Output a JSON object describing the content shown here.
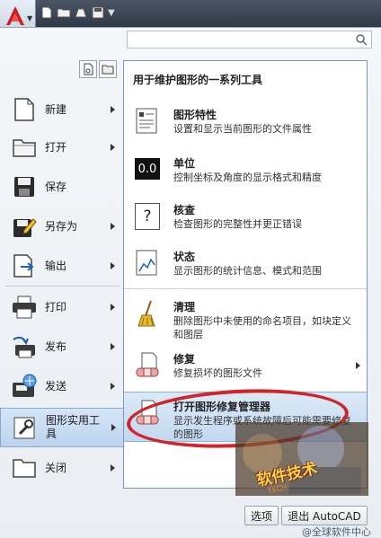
{
  "search": {
    "placeholder": ""
  },
  "left_menu": [
    {
      "label": "新建",
      "has_arrow": true
    },
    {
      "label": "打开",
      "has_arrow": true
    },
    {
      "label": "保存",
      "has_arrow": false
    },
    {
      "label": "另存为",
      "has_arrow": true
    },
    {
      "label": "输出",
      "has_arrow": true
    },
    {
      "label": "打印",
      "has_arrow": true
    },
    {
      "label": "发布",
      "has_arrow": true
    },
    {
      "label": "发送",
      "has_arrow": true
    },
    {
      "label_line1": "图形实用工",
      "label_line2": "具",
      "has_arrow": true,
      "active": true
    },
    {
      "label": "关闭",
      "has_arrow": true
    }
  ],
  "panel": {
    "title": "用于维护图形的一系列工具",
    "items": [
      {
        "title": "图形特性",
        "desc": "设置和显示当前图形的文件属性"
      },
      {
        "title": "单位",
        "desc": "控制坐标及角度的显示格式和精度",
        "icon_text": "0.0"
      },
      {
        "title": "核查",
        "desc": "检查图形的完整性并更正错误",
        "icon_text": "?"
      },
      {
        "title": "状态",
        "desc": "显示图形的统计信息、模式和范围"
      },
      {
        "title": "清理",
        "desc": "删除图形中未使用的命名项目，如块定义和图层"
      },
      {
        "title": "修复",
        "desc": "修复损坏的图形文件",
        "has_arrow": true
      },
      {
        "title": "打开图形修复管理器",
        "desc": "显示发生程序或系统故障后可能需要修复的图形"
      }
    ]
  },
  "buttons": {
    "options": "选项",
    "exit": "退出 AutoCAD"
  },
  "watermark": {
    "main": "软件技术",
    "sub": "TECH",
    "bottom": "@全球软件中心"
  },
  "colors": {
    "highlight_ring": "#d0232a",
    "accent": "#86a9d2"
  }
}
